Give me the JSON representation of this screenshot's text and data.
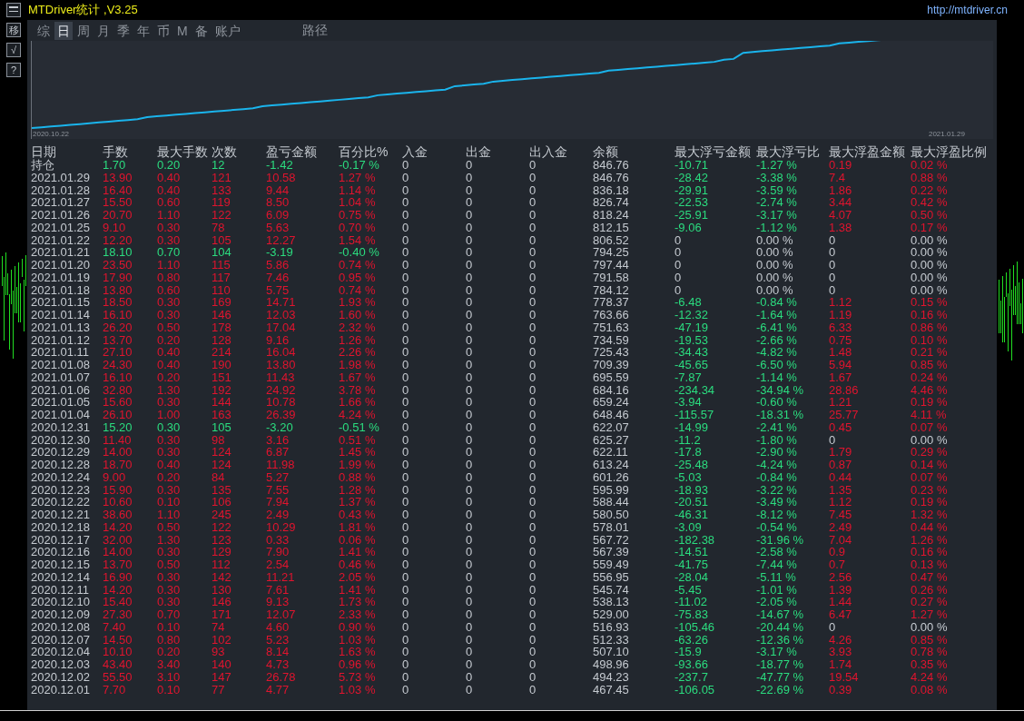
{
  "window": {
    "title": "MTDriver统计 ,V3.25",
    "url": "http://mtdriver.cn"
  },
  "toolbar": [
    {
      "kind": "icon"
    },
    {
      "kind": "text",
      "label": "移"
    },
    {
      "kind": "text",
      "label": "√"
    },
    {
      "kind": "text",
      "label": "?"
    }
  ],
  "tabs": [
    {
      "label": "综",
      "selected": false
    },
    {
      "label": "日",
      "selected": true
    },
    {
      "label": "周",
      "selected": false
    },
    {
      "label": "月",
      "selected": false
    },
    {
      "label": "季",
      "selected": false
    },
    {
      "label": "年",
      "selected": false
    },
    {
      "label": "币",
      "selected": false
    },
    {
      "label": "M",
      "selected": false
    },
    {
      "label": "备",
      "selected": false
    },
    {
      "label": "账户",
      "selected": false
    }
  ],
  "path_button": "路径",
  "balance_chart": {
    "start_label": "2020.10.22",
    "end_label": "2021.01.29"
  },
  "table": {
    "columns": [
      "日期",
      "手数",
      "最大手数",
      "次数",
      "盈亏金额",
      "百分比%",
      "入金",
      "出金",
      "出入金",
      "余额",
      "最大浮亏金额",
      "最大浮亏比",
      "最大浮盈金额",
      "最大浮盈比例"
    ],
    "rows": [
      {
        "cells": [
          "持仓",
          "1.70",
          "0.20",
          "12",
          "-1.42",
          "-0.17 %",
          "0",
          "0",
          "0",
          "846.76",
          "-10.71",
          "-1.27 %",
          "0.19",
          "0.02 %"
        ],
        "gain": false,
        "float_loss": true,
        "float_gain": true
      },
      {
        "cells": [
          "2021.01.29",
          "13.90",
          "0.40",
          "121",
          "10.58",
          "1.27 %",
          "0",
          "0",
          "0",
          "846.76",
          "-28.42",
          "-3.38 %",
          "7.4",
          "0.88 %"
        ],
        "gain": true,
        "float_loss": true,
        "float_gain": true
      },
      {
        "cells": [
          "2021.01.28",
          "16.40",
          "0.40",
          "133",
          "9.44",
          "1.14 %",
          "0",
          "0",
          "0",
          "836.18",
          "-29.91",
          "-3.59 %",
          "1.86",
          "0.22 %"
        ],
        "gain": true,
        "float_loss": true,
        "float_gain": true
      },
      {
        "cells": [
          "2021.01.27",
          "15.50",
          "0.60",
          "119",
          "8.50",
          "1.04 %",
          "0",
          "0",
          "0",
          "826.74",
          "-22.53",
          "-2.74 %",
          "3.44",
          "0.42 %"
        ],
        "gain": true,
        "float_loss": true,
        "float_gain": true
      },
      {
        "cells": [
          "2021.01.26",
          "20.70",
          "1.10",
          "122",
          "6.09",
          "0.75 %",
          "0",
          "0",
          "0",
          "818.24",
          "-25.91",
          "-3.17 %",
          "4.07",
          "0.50 %"
        ],
        "gain": true,
        "float_loss": true,
        "float_gain": true
      },
      {
        "cells": [
          "2021.01.25",
          "9.10",
          "0.30",
          "78",
          "5.63",
          "0.70 %",
          "0",
          "0",
          "0",
          "812.15",
          "-9.06",
          "-1.12 %",
          "1.38",
          "0.17 %"
        ],
        "gain": true,
        "float_loss": true,
        "float_gain": true
      },
      {
        "cells": [
          "2021.01.22",
          "12.20",
          "0.30",
          "105",
          "12.27",
          "1.54 %",
          "0",
          "0",
          "0",
          "806.52",
          "0",
          "0.00 %",
          "0",
          "0.00 %"
        ],
        "gain": true,
        "float_loss": false,
        "float_gain": false
      },
      {
        "cells": [
          "2021.01.21",
          "18.10",
          "0.70",
          "104",
          "-3.19",
          "-0.40 %",
          "0",
          "0",
          "0",
          "794.25",
          "0",
          "0.00 %",
          "0",
          "0.00 %"
        ],
        "gain": false,
        "float_loss": false,
        "float_gain": false
      },
      {
        "cells": [
          "2021.01.20",
          "23.50",
          "1.10",
          "115",
          "5.86",
          "0.74 %",
          "0",
          "0",
          "0",
          "797.44",
          "0",
          "0.00 %",
          "0",
          "0.00 %"
        ],
        "gain": true,
        "float_loss": false,
        "float_gain": false
      },
      {
        "cells": [
          "2021.01.19",
          "17.90",
          "0.80",
          "117",
          "7.46",
          "0.95 %",
          "0",
          "0",
          "0",
          "791.58",
          "0",
          "0.00 %",
          "0",
          "0.00 %"
        ],
        "gain": true,
        "float_loss": false,
        "float_gain": false
      },
      {
        "cells": [
          "2021.01.18",
          "13.80",
          "0.60",
          "110",
          "5.75",
          "0.74 %",
          "0",
          "0",
          "0",
          "784.12",
          "0",
          "0.00 %",
          "0",
          "0.00 %"
        ],
        "gain": true,
        "float_loss": false,
        "float_gain": false
      },
      {
        "cells": [
          "2021.01.15",
          "18.50",
          "0.30",
          "169",
          "14.71",
          "1.93 %",
          "0",
          "0",
          "0",
          "778.37",
          "-6.48",
          "-0.84 %",
          "1.12",
          "0.15 %"
        ],
        "gain": true,
        "float_loss": true,
        "float_gain": true
      },
      {
        "cells": [
          "2021.01.14",
          "16.10",
          "0.30",
          "146",
          "12.03",
          "1.60 %",
          "0",
          "0",
          "0",
          "763.66",
          "-12.32",
          "-1.64 %",
          "1.19",
          "0.16 %"
        ],
        "gain": true,
        "float_loss": true,
        "float_gain": true
      },
      {
        "cells": [
          "2021.01.13",
          "26.20",
          "0.50",
          "178",
          "17.04",
          "2.32 %",
          "0",
          "0",
          "0",
          "751.63",
          "-47.19",
          "-6.41 %",
          "6.33",
          "0.86 %"
        ],
        "gain": true,
        "float_loss": true,
        "float_gain": true
      },
      {
        "cells": [
          "2021.01.12",
          "13.70",
          "0.20",
          "128",
          "9.16",
          "1.26 %",
          "0",
          "0",
          "0",
          "734.59",
          "-19.53",
          "-2.66 %",
          "0.75",
          "0.10 %"
        ],
        "gain": true,
        "float_loss": true,
        "float_gain": true
      },
      {
        "cells": [
          "2021.01.11",
          "27.10",
          "0.40",
          "214",
          "16.04",
          "2.26 %",
          "0",
          "0",
          "0",
          "725.43",
          "-34.43",
          "-4.82 %",
          "1.48",
          "0.21 %"
        ],
        "gain": true,
        "float_loss": true,
        "float_gain": true
      },
      {
        "cells": [
          "2021.01.08",
          "24.30",
          "0.40",
          "190",
          "13.80",
          "1.98 %",
          "0",
          "0",
          "0",
          "709.39",
          "-45.65",
          "-6.50 %",
          "5.94",
          "0.85 %"
        ],
        "gain": true,
        "float_loss": true,
        "float_gain": true
      },
      {
        "cells": [
          "2021.01.07",
          "16.10",
          "0.20",
          "151",
          "11.43",
          "1.67 %",
          "0",
          "0",
          "0",
          "695.59",
          "-7.87",
          "-1.14 %",
          "1.67",
          "0.24 %"
        ],
        "gain": true,
        "float_loss": true,
        "float_gain": true
      },
      {
        "cells": [
          "2021.01.06",
          "32.80",
          "1.30",
          "192",
          "24.92",
          "3.78 %",
          "0",
          "0",
          "0",
          "684.16",
          "-234.34",
          "-34.94 %",
          "28.86",
          "4.46 %"
        ],
        "gain": true,
        "float_loss": true,
        "float_gain": true
      },
      {
        "cells": [
          "2021.01.05",
          "15.60",
          "0.30",
          "144",
          "10.78",
          "1.66 %",
          "0",
          "0",
          "0",
          "659.24",
          "-3.94",
          "-0.60 %",
          "1.21",
          "0.19 %"
        ],
        "gain": true,
        "float_loss": true,
        "float_gain": true
      },
      {
        "cells": [
          "2021.01.04",
          "26.10",
          "1.00",
          "163",
          "26.39",
          "4.24 %",
          "0",
          "0",
          "0",
          "648.46",
          "-115.57",
          "-18.31 %",
          "25.77",
          "4.11 %"
        ],
        "gain": true,
        "float_loss": true,
        "float_gain": true
      },
      {
        "cells": [
          "2020.12.31",
          "15.20",
          "0.30",
          "105",
          "-3.20",
          "-0.51 %",
          "0",
          "0",
          "0",
          "622.07",
          "-14.99",
          "-2.41 %",
          "0.45",
          "0.07 %"
        ],
        "gain": false,
        "float_loss": true,
        "float_gain": true
      },
      {
        "cells": [
          "2020.12.30",
          "11.40",
          "0.30",
          "98",
          "3.16",
          "0.51 %",
          "0",
          "0",
          "0",
          "625.27",
          "-11.2",
          "-1.80 %",
          "0",
          "0.00 %"
        ],
        "gain": true,
        "float_loss": true,
        "float_gain": false
      },
      {
        "cells": [
          "2020.12.29",
          "14.00",
          "0.30",
          "124",
          "6.87",
          "1.45 %",
          "0",
          "0",
          "0",
          "622.11",
          "-17.8",
          "-2.90 %",
          "1.79",
          "0.29 %"
        ],
        "gain": true,
        "float_loss": true,
        "float_gain": true
      },
      {
        "cells": [
          "2020.12.28",
          "18.70",
          "0.40",
          "124",
          "11.98",
          "1.99 %",
          "0",
          "0",
          "0",
          "613.24",
          "-25.48",
          "-4.24 %",
          "0.87",
          "0.14 %"
        ],
        "gain": true,
        "float_loss": true,
        "float_gain": true
      },
      {
        "cells": [
          "2020.12.24",
          "9.00",
          "0.20",
          "84",
          "5.27",
          "0.88 %",
          "0",
          "0",
          "0",
          "601.26",
          "-5.03",
          "-0.84 %",
          "0.44",
          "0.07 %"
        ],
        "gain": true,
        "float_loss": true,
        "float_gain": true
      },
      {
        "cells": [
          "2020.12.23",
          "15.90",
          "0.30",
          "135",
          "7.55",
          "1.28 %",
          "0",
          "0",
          "0",
          "595.99",
          "-18.93",
          "-3.22 %",
          "1.35",
          "0.23 %"
        ],
        "gain": true,
        "float_loss": true,
        "float_gain": true
      },
      {
        "cells": [
          "2020.12.22",
          "10.60",
          "0.10",
          "106",
          "7.94",
          "1.37 %",
          "0",
          "0",
          "0",
          "588.44",
          "-20.51",
          "-3.49 %",
          "1.12",
          "0.19 %"
        ],
        "gain": true,
        "float_loss": true,
        "float_gain": true
      },
      {
        "cells": [
          "2020.12.21",
          "38.60",
          "1.10",
          "245",
          "2.49",
          "0.43 %",
          "0",
          "0",
          "0",
          "580.50",
          "-46.31",
          "-8.12 %",
          "7.45",
          "1.32 %"
        ],
        "gain": true,
        "float_loss": true,
        "float_gain": true
      },
      {
        "cells": [
          "2020.12.18",
          "14.20",
          "0.50",
          "122",
          "10.29",
          "1.81 %",
          "0",
          "0",
          "0",
          "578.01",
          "-3.09",
          "-0.54 %",
          "2.49",
          "0.44 %"
        ],
        "gain": true,
        "float_loss": true,
        "float_gain": true
      },
      {
        "cells": [
          "2020.12.17",
          "32.00",
          "1.30",
          "123",
          "0.33",
          "0.06 %",
          "0",
          "0",
          "0",
          "567.72",
          "-182.38",
          "-31.96 %",
          "7.04",
          "1.26 %"
        ],
        "gain": true,
        "float_loss": true,
        "float_gain": true
      },
      {
        "cells": [
          "2020.12.16",
          "14.00",
          "0.30",
          "129",
          "7.90",
          "1.41 %",
          "0",
          "0",
          "0",
          "567.39",
          "-14.51",
          "-2.58 %",
          "0.9",
          "0.16 %"
        ],
        "gain": true,
        "float_loss": true,
        "float_gain": true
      },
      {
        "cells": [
          "2020.12.15",
          "13.70",
          "0.50",
          "112",
          "2.54",
          "0.46 %",
          "0",
          "0",
          "0",
          "559.49",
          "-41.75",
          "-7.44 %",
          "0.7",
          "0.13 %"
        ],
        "gain": true,
        "float_loss": true,
        "float_gain": true
      },
      {
        "cells": [
          "2020.12.14",
          "16.90",
          "0.30",
          "142",
          "11.21",
          "2.05 %",
          "0",
          "0",
          "0",
          "556.95",
          "-28.04",
          "-5.11 %",
          "2.56",
          "0.47 %"
        ],
        "gain": true,
        "float_loss": true,
        "float_gain": true
      },
      {
        "cells": [
          "2020.12.11",
          "14.20",
          "0.30",
          "130",
          "7.61",
          "1.41 %",
          "0",
          "0",
          "0",
          "545.74",
          "-5.45",
          "-1.01 %",
          "1.39",
          "0.26 %"
        ],
        "gain": true,
        "float_loss": true,
        "float_gain": true
      },
      {
        "cells": [
          "2020.12.10",
          "15.40",
          "0.30",
          "146",
          "9.13",
          "1.73 %",
          "0",
          "0",
          "0",
          "538.13",
          "-11.02",
          "-2.05 %",
          "1.44",
          "0.27 %"
        ],
        "gain": true,
        "float_loss": true,
        "float_gain": true
      },
      {
        "cells": [
          "2020.12.09",
          "27.30",
          "0.70",
          "171",
          "12.07",
          "2.33 %",
          "0",
          "0",
          "0",
          "529.00",
          "-75.83",
          "-14.67 %",
          "6.47",
          "1.27 %"
        ],
        "gain": true,
        "float_loss": true,
        "float_gain": true
      },
      {
        "cells": [
          "2020.12.08",
          "7.40",
          "0.10",
          "74",
          "4.60",
          "0.90 %",
          "0",
          "0",
          "0",
          "516.93",
          "-105.46",
          "-20.44 %",
          "0",
          "0.00 %"
        ],
        "gain": true,
        "float_loss": true,
        "float_gain": false
      },
      {
        "cells": [
          "2020.12.07",
          "14.50",
          "0.80",
          "102",
          "5.23",
          "1.03 %",
          "0",
          "0",
          "0",
          "512.33",
          "-63.26",
          "-12.36 %",
          "4.26",
          "0.85 %"
        ],
        "gain": true,
        "float_loss": true,
        "float_gain": true
      },
      {
        "cells": [
          "2020.12.04",
          "10.10",
          "0.20",
          "93",
          "8.14",
          "1.63 %",
          "0",
          "0",
          "0",
          "507.10",
          "-15.9",
          "-3.17 %",
          "3.93",
          "0.78 %"
        ],
        "gain": true,
        "float_loss": true,
        "float_gain": true
      },
      {
        "cells": [
          "2020.12.03",
          "43.40",
          "3.40",
          "140",
          "4.73",
          "0.96 %",
          "0",
          "0",
          "0",
          "498.96",
          "-93.66",
          "-18.77 %",
          "1.74",
          "0.35 %"
        ],
        "gain": true,
        "float_loss": true,
        "float_gain": true
      },
      {
        "cells": [
          "2020.12.02",
          "55.50",
          "3.10",
          "147",
          "26.78",
          "5.73 %",
          "0",
          "0",
          "0",
          "494.23",
          "-237.7",
          "-47.77 %",
          "19.54",
          "4.24 %"
        ],
        "gain": true,
        "float_loss": true,
        "float_gain": true
      },
      {
        "cells": [
          "2020.12.01",
          "7.70",
          "0.10",
          "77",
          "4.77",
          "1.03 %",
          "0",
          "0",
          "0",
          "467.45",
          "-106.05",
          "-22.69 %",
          "0.39",
          "0.08 %"
        ],
        "gain": true,
        "float_loss": true,
        "float_gain": true
      }
    ]
  }
}
